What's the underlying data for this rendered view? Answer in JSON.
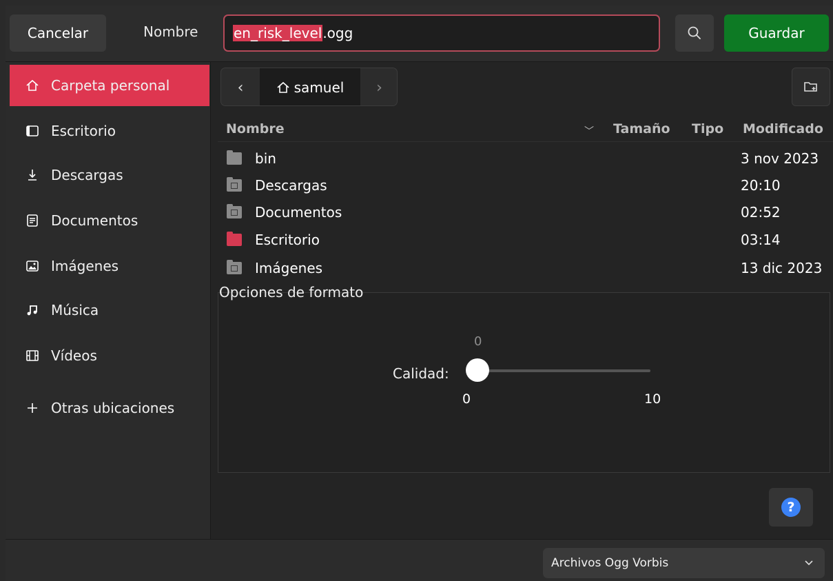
{
  "header": {
    "cancel_label": "Cancelar",
    "name_label": "Nombre",
    "filename_selected": "en_risk_level",
    "filename_rest": ".ogg",
    "save_label": "Guardar"
  },
  "sidebar": {
    "items": [
      {
        "label": "Carpeta personal",
        "icon": "home-icon"
      },
      {
        "label": "Escritorio",
        "icon": "desktop-icon"
      },
      {
        "label": "Descargas",
        "icon": "download-icon"
      },
      {
        "label": "Documentos",
        "icon": "document-icon"
      },
      {
        "label": "Imágenes",
        "icon": "image-icon"
      },
      {
        "label": "Música",
        "icon": "music-icon"
      },
      {
        "label": "Vídeos",
        "icon": "video-icon"
      },
      {
        "label": "Otras ubicaciones",
        "icon": "plus-icon"
      }
    ]
  },
  "pathbar": {
    "current": "samuel"
  },
  "files": {
    "columns": [
      "Nombre",
      "Tamaño",
      "Tipo",
      "Modificado"
    ],
    "rows": [
      {
        "name": "bin",
        "modified": "3 nov 2023"
      },
      {
        "name": "Descargas",
        "modified": "20:10"
      },
      {
        "name": "Documentos",
        "modified": "02:52"
      },
      {
        "name": "Escritorio",
        "modified": "03:14"
      },
      {
        "name": "Imágenes",
        "modified": "13 dic 2023"
      }
    ]
  },
  "format_options": {
    "title": "Opciones de formato",
    "quality_label": "Calidad:",
    "quality_value": "0",
    "quality_min": "0",
    "quality_max": "10"
  },
  "filter": {
    "selected": "Archivos Ogg Vorbis"
  },
  "colors": {
    "accent": "#de3650",
    "save": "#0d7a24",
    "help": "#3b82f6"
  }
}
